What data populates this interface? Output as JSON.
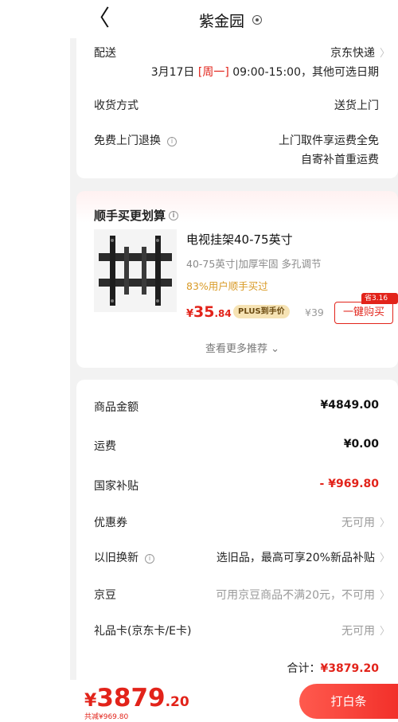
{
  "header": {
    "back_label": "〈",
    "title": "紫金园"
  },
  "delivery": {
    "label": "配送",
    "carrier": "京东快递",
    "date_prefix": "3月17日 ",
    "weekday": "[周一]",
    "time_suffix": " 09:00-15:00，其他可选日期"
  },
  "receive": {
    "label": "收货方式",
    "value": "送货上门"
  },
  "free_return": {
    "label": "免费上门退换",
    "line1": "上门取件享运费全免",
    "line2": "自寄补首重运费"
  },
  "recommend": {
    "title": "顺手买更划算",
    "product_name": "电视挂架40-75英寸",
    "product_sub": "40-75英寸|加厚牢固 多孔调节",
    "product_stat": "83%用户顺手买过",
    "price_currency": "¥",
    "price_int": "35",
    "price_dec": ".84",
    "plus_tag": "PLUS到手价",
    "orig_price": "¥39",
    "save_tag": "省3.16元",
    "buy_button": "一键购买",
    "more": "查看更多推荐 ⌄"
  },
  "summary": {
    "goods_label": "商品金额",
    "goods_value": "¥4849.00",
    "shipping_label": "运费",
    "shipping_value": "¥0.00",
    "subsidy_label": "国家补贴",
    "subsidy_value": "- ¥969.80",
    "coupon_label": "优惠券",
    "coupon_value": "无可用",
    "tradein_label": "以旧换新",
    "tradein_value": "选旧品，最高可享20%新品补贴",
    "jingdou_label": "京豆",
    "jingdou_value": "可用京豆商品不满20元，不可用",
    "giftcard_label": "礼品卡(京东卡/E卡)",
    "giftcard_value": "无可用",
    "total_label": "合计：",
    "total_value": "¥3879.20"
  },
  "bottom": {
    "currency": "¥",
    "total_int": "3879",
    "total_dec": ".20",
    "saved": "共减¥969.80",
    "pay_button": "打白条"
  },
  "colors": {
    "accent": "#e2231a",
    "background": "#f2f2f2"
  }
}
